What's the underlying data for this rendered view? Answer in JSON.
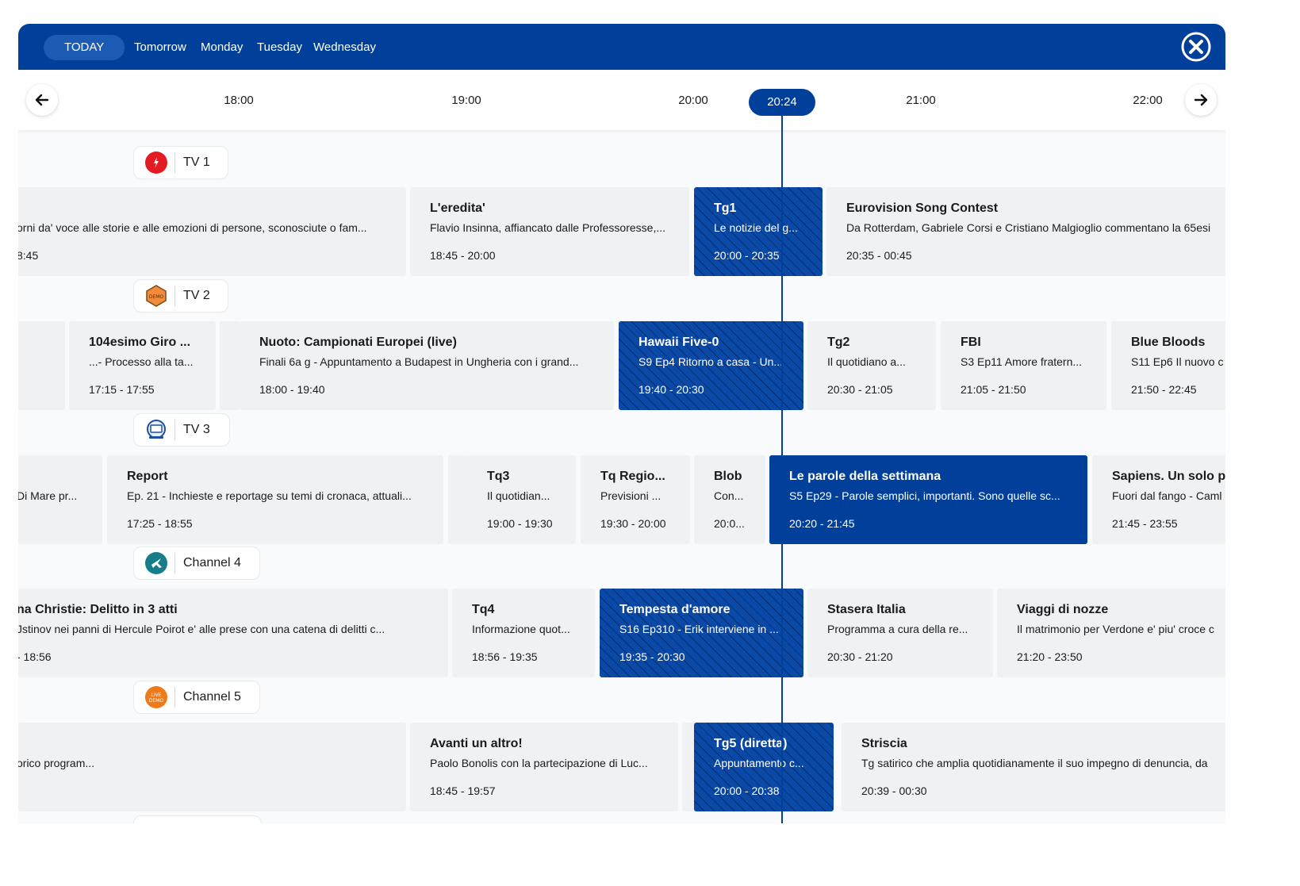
{
  "days": {
    "today": "TODAY",
    "tomorrow": "Tomorrow",
    "monday": "Monday",
    "tuesday": "Tuesday",
    "wednesday": "Wednesday"
  },
  "timeline": {
    "t1800": "18:00",
    "t1900": "19:00",
    "t2000": "20:00",
    "now": "20:24",
    "t2100": "21:00",
    "t2200": "22:00"
  },
  "channels": {
    "c1": {
      "name": "TV 1",
      "p0": {
        "desc": "orni da' voce alle storie e alle emozioni di persone, sconosciute o fam...",
        "time": "8:45"
      },
      "p1": {
        "title": "L'eredita'",
        "desc": "Flavio Insinna, affiancato dalle Professoresse,...",
        "time": "18:45 - 20:00"
      },
      "p2": {
        "title": "Tg1",
        "desc": "Le notizie del g...",
        "time": "20:00 - 20:35"
      },
      "p3": {
        "title": "Eurovision Song Contest",
        "desc": "Da Rotterdam, Gabriele Corsi e Cristiano Malgioglio commentano la 65esi",
        "time": "20:35 - 00:45"
      }
    },
    "c2": {
      "name": "TV 2",
      "p1": {
        "title": "104esimo Giro ...",
        "desc": "...- Processo alla ta...",
        "time": "17:15 - 17:55"
      },
      "p2": {
        "title": "Nuoto: Campionati Europei (live)",
        "desc": "Finali 6a g - Appuntamento a Budapest in Ungheria con i grand...",
        "time": "18:00 - 19:40"
      },
      "p3": {
        "title": "Hawaii Five-0",
        "desc": "S9 Ep4 Ritorno a casa - Un...",
        "time": "19:40 - 20:30"
      },
      "p4": {
        "title": "Tg2",
        "desc": "Il quotidiano a...",
        "time": "20:30 - 21:05"
      },
      "p5": {
        "title": "FBI",
        "desc": "S3 Ep11 Amore fratern...",
        "time": "21:05 - 21:50"
      },
      "p6": {
        "title": "Blue Bloods",
        "desc": "S11 Ep6 Il nuovo c",
        "time": "21:50 - 22:45"
      }
    },
    "c3": {
      "name": "TV 3",
      "p0": {
        "desc": "Di Mare pr..."
      },
      "p1": {
        "title": "Report",
        "desc": "Ep. 21 - Inchieste e reportage su temi di cronaca, attuali...",
        "time": "17:25 - 18:55"
      },
      "p2": {
        "title": "Tq3",
        "desc": "Il quotidian...",
        "time": "19:00 - 19:30"
      },
      "p3": {
        "title": "Tq Regio...",
        "desc": "Previsioni ...",
        "time": "19:30 - 20:00"
      },
      "p4": {
        "title": "Blob",
        "desc": "Con...",
        "time": "20:0..."
      },
      "p5": {
        "title": "Le parole della settimana",
        "desc": "S5 Ep29 - Parole semplici, importanti. Sono quelle sc...",
        "time": "20:20 - 21:45"
      },
      "p6": {
        "title": "Sapiens. Un solo pi",
        "desc": "Fuori dal fango - Caml",
        "time": "21:45 - 23:55"
      }
    },
    "c4": {
      "name": "Channel 4",
      "p0": {
        "title": "na Christie: Delitto in 3 atti",
        "desc": "Jstinov nei panni di Hercule Poirot e' alle prese con una catena di delitti c...",
        "time": "- 18:56"
      },
      "p1": {
        "title": "Tq4",
        "desc": "Informazione quot...",
        "time": "18:56 - 19:35"
      },
      "p2": {
        "title": "Tempesta d'amore",
        "desc": "S16 Ep310 - Erik interviene in ...",
        "time": "19:35 - 20:30"
      },
      "p3": {
        "title": "Stasera Italia",
        "desc": "Programma a cura della re...",
        "time": "20:30 - 21:20"
      },
      "p4": {
        "title": "Viaggi di nozze",
        "desc": "Il matrimonio per Verdone e' piu' croce c",
        "time": "21:20 - 23:50"
      }
    },
    "c5": {
      "name": "Channel 5",
      "p0": {
        "desc": "orico program..."
      },
      "p1": {
        "title": "Avanti un altro!",
        "desc": "Paolo Bonolis con la partecipazione di Luc...",
        "time": "18:45 - 19:57"
      },
      "p2": {
        "title": "Tg5 (diretta)",
        "desc": "Appuntamento c...",
        "time": "20:00 - 20:38"
      },
      "p3": {
        "title": "Striscia",
        "desc": "Tg satirico che amplia quotidianamente il suo impegno di denuncia, da",
        "time": "20:39 - 00:30"
      }
    }
  },
  "logos": {
    "c2": "DEMO",
    "c5a": "LIVE",
    "c5b": "DEMO"
  },
  "colors": {
    "brand": "#003f9a",
    "card": "#f0f1f3"
  }
}
